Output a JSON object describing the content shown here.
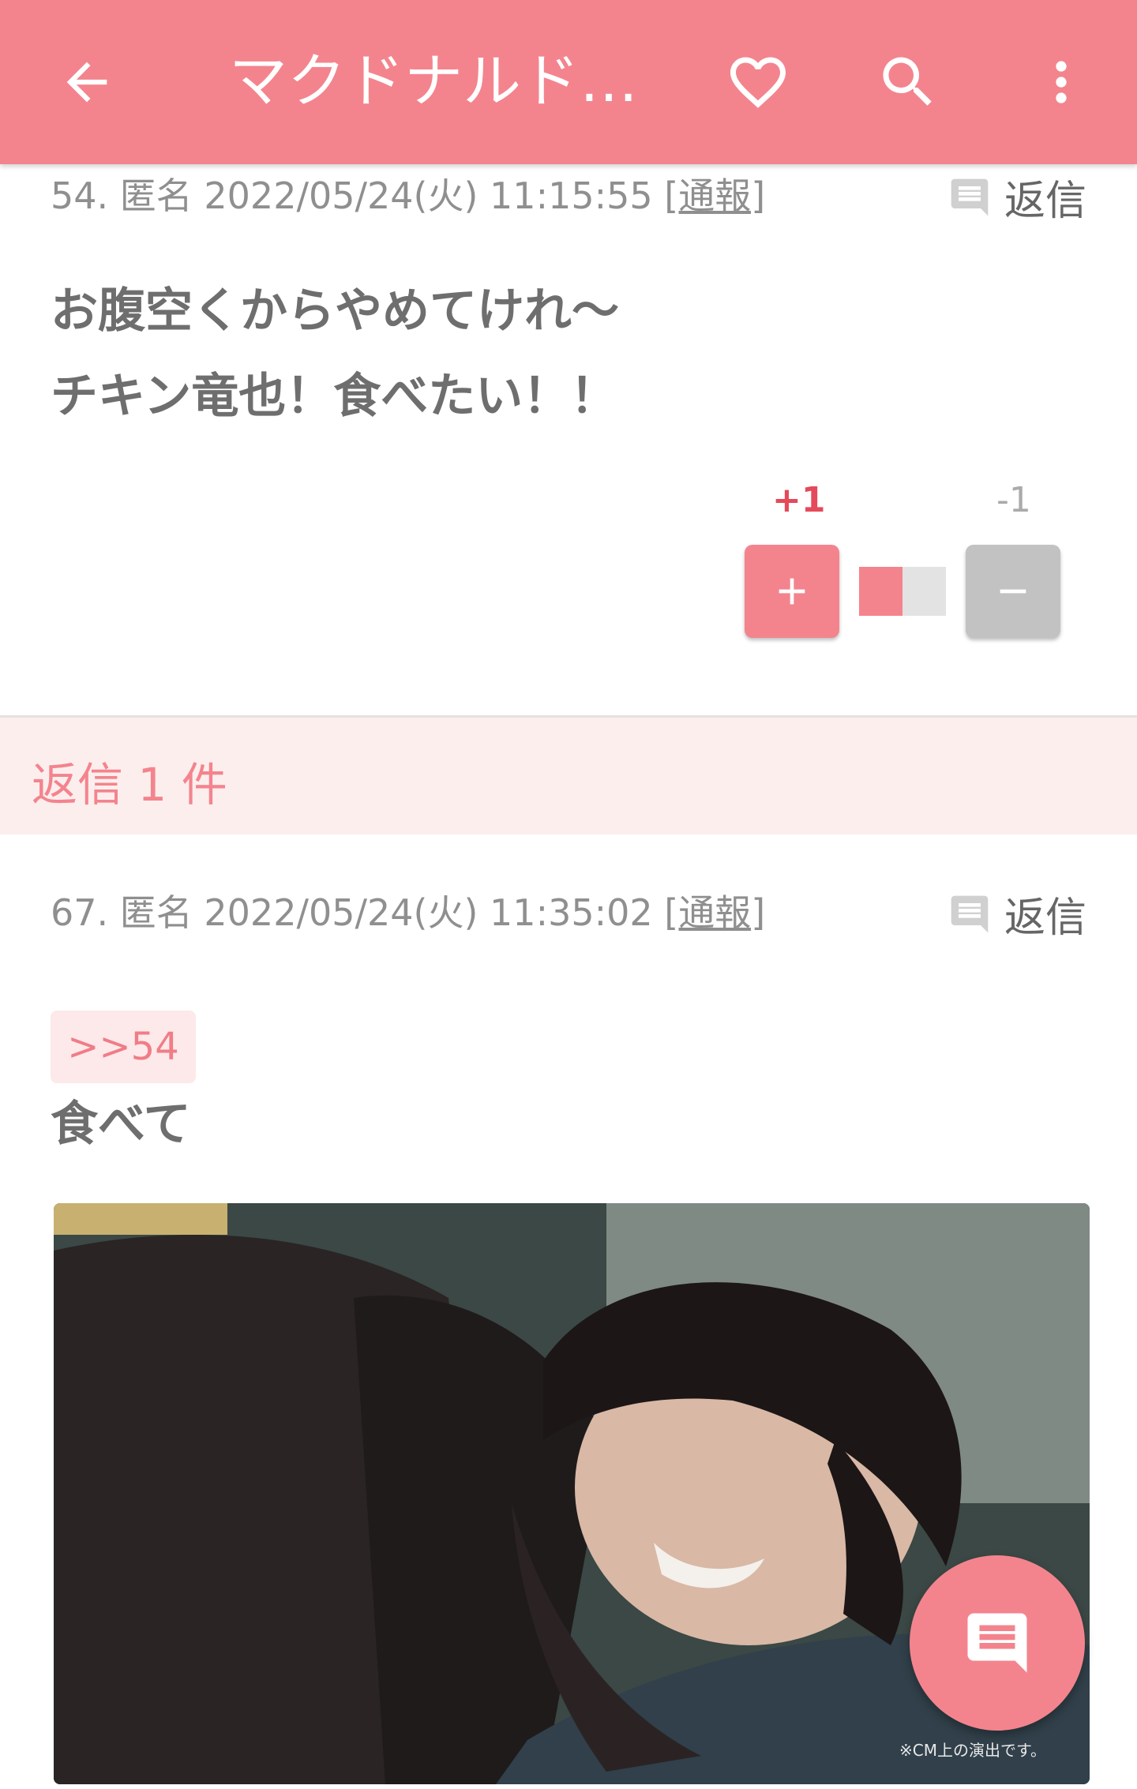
{
  "appbar": {
    "title": "マクドナルド…",
    "icons": [
      "back-arrow-icon",
      "heart-icon",
      "search-icon",
      "more-vert-icon"
    ]
  },
  "comment1": {
    "meta_prefix": "54. 匿名 2022/05/24(火) 11:15:55 ",
    "report": "[通報]",
    "reply_label": "返信",
    "lines": [
      "お腹空くからやめてけれ〜",
      "チキン竜也！食べたい！！"
    ],
    "plus_count": "+1",
    "minus_count": "-1",
    "vote_ratio_plus": 0.5
  },
  "replies_bar": {
    "label": "返信 1 件"
  },
  "comment2": {
    "meta_prefix": "67. 匿名 2022/05/24(火) 11:35:02 ",
    "report": "[通報]",
    "reply_label": "返信",
    "anchor": ">>54",
    "text": "食べて",
    "image_caption": "※CM上の演出です。"
  },
  "colors": {
    "brand_pink": "#f3848d",
    "light_pink": "#fdeeee",
    "plus_red": "#e44a5a"
  }
}
